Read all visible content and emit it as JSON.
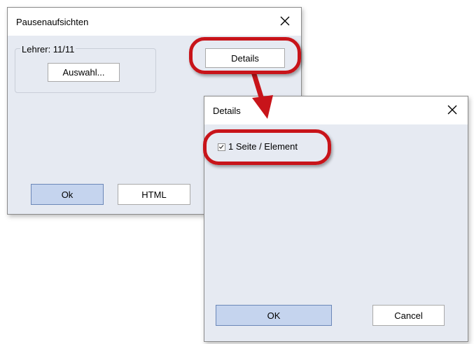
{
  "dialog_pausen": {
    "title": "Pausenaufsichten",
    "group_label": "Lehrer: 11/11",
    "auswahl_label": "Auswahl...",
    "details_label": "Details",
    "ok_label": "Ok",
    "html_label": "HTML"
  },
  "dialog_details": {
    "title": "Details",
    "checkbox_label": "1 Seite / Element",
    "checkbox_checked": true,
    "ok_label": "OK",
    "cancel_label": "Cancel"
  },
  "colors": {
    "client_background": "#e6eaf2",
    "primary_button": "#c5d4ee",
    "highlight_red": "#c8141a"
  }
}
